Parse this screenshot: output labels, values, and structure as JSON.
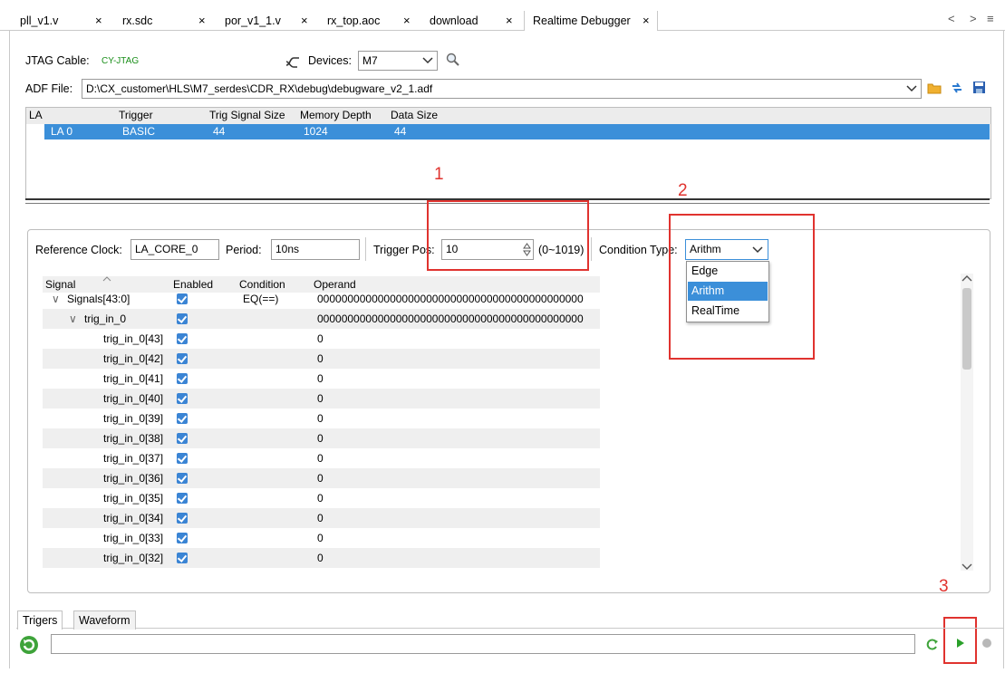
{
  "tabs": [
    {
      "label": "pll_v1.v",
      "active": false
    },
    {
      "label": "rx.sdc",
      "active": false
    },
    {
      "label": "por_v1_1.v",
      "active": false
    },
    {
      "label": "rx_top.aoc",
      "active": false
    },
    {
      "label": "download",
      "active": false
    },
    {
      "label": "Realtime Debugger",
      "active": true
    }
  ],
  "tab_close_glyph": "×",
  "nav": {
    "prev": "<",
    "next": ">",
    "menu": "≡"
  },
  "jtag": {
    "label": "JTAG Cable:",
    "value": "CY-JTAG",
    "value_color": "#1a8f1a"
  },
  "devices": {
    "label": "Devices:",
    "value": "M7",
    "icon": "cable-icon",
    "search_icon": "magnifier-icon"
  },
  "adf": {
    "label": "ADF File:",
    "path": "D:\\CX_customer\\HLS\\M7_serdes\\CDR_RX\\debug\\debugware_v2_1.adf"
  },
  "la_table": {
    "headers": [
      "LA",
      "Trigger",
      "Trig Signal Size",
      "Memory Depth",
      "Data Size"
    ],
    "rows": [
      [
        "LA 0",
        "BASIC",
        "44",
        "1024",
        "44"
      ]
    ]
  },
  "settings": {
    "ref_clock_label": "Reference Clock:",
    "ref_clock_value": "LA_CORE_0",
    "period_label": "Period:",
    "period_value": "10ns",
    "trigger_pos_label": "Trigger Pos:",
    "trigger_pos_value": "10",
    "trigger_pos_range": "(0~1019)",
    "condition_type_label": "Condition Type:",
    "condition_type_value": "Arithm"
  },
  "dropdown": {
    "options": [
      "Edge",
      "Arithm",
      "RealTime"
    ],
    "selected": "Arithm"
  },
  "signal_table": {
    "headers": [
      "Signal",
      "Enabled",
      "Condition",
      "Operand"
    ],
    "rows": [
      {
        "name": "Signals[43:0]",
        "expander": "∨",
        "condition": "EQ(==)",
        "operand": "00000000000000000000000000000000000000000000"
      },
      {
        "name": "trig_in_0",
        "expander": "∨",
        "condition": "",
        "operand": "00000000000000000000000000000000000000000000"
      },
      {
        "name": "trig_in_0[43]",
        "expander": "",
        "condition": "",
        "operand": "0"
      },
      {
        "name": "trig_in_0[42]",
        "expander": "",
        "condition": "",
        "operand": "0"
      },
      {
        "name": "trig_in_0[41]",
        "expander": "",
        "condition": "",
        "operand": "0"
      },
      {
        "name": "trig_in_0[40]",
        "expander": "",
        "condition": "",
        "operand": "0"
      },
      {
        "name": "trig_in_0[39]",
        "expander": "",
        "condition": "",
        "operand": "0"
      },
      {
        "name": "trig_in_0[38]",
        "expander": "",
        "condition": "",
        "operand": "0"
      },
      {
        "name": "trig_in_0[37]",
        "expander": "",
        "condition": "",
        "operand": "0"
      },
      {
        "name": "trig_in_0[36]",
        "expander": "",
        "condition": "",
        "operand": "0"
      },
      {
        "name": "trig_in_0[35]",
        "expander": "",
        "condition": "",
        "operand": "0"
      },
      {
        "name": "trig_in_0[34]",
        "expander": "",
        "condition": "",
        "operand": "0"
      },
      {
        "name": "trig_in_0[33]",
        "expander": "",
        "condition": "",
        "operand": "0"
      },
      {
        "name": "trig_in_0[32]",
        "expander": "",
        "condition": "",
        "operand": "0"
      }
    ]
  },
  "annotations": [
    "1",
    "2",
    "3"
  ],
  "bottom_tabs": [
    {
      "label": "Trigers",
      "active": true
    },
    {
      "label": "Waveform",
      "active": false
    }
  ],
  "colors": {
    "accent": "#3b8fd9",
    "annotation": "#e0332f",
    "run_green": "#2aa02a"
  }
}
